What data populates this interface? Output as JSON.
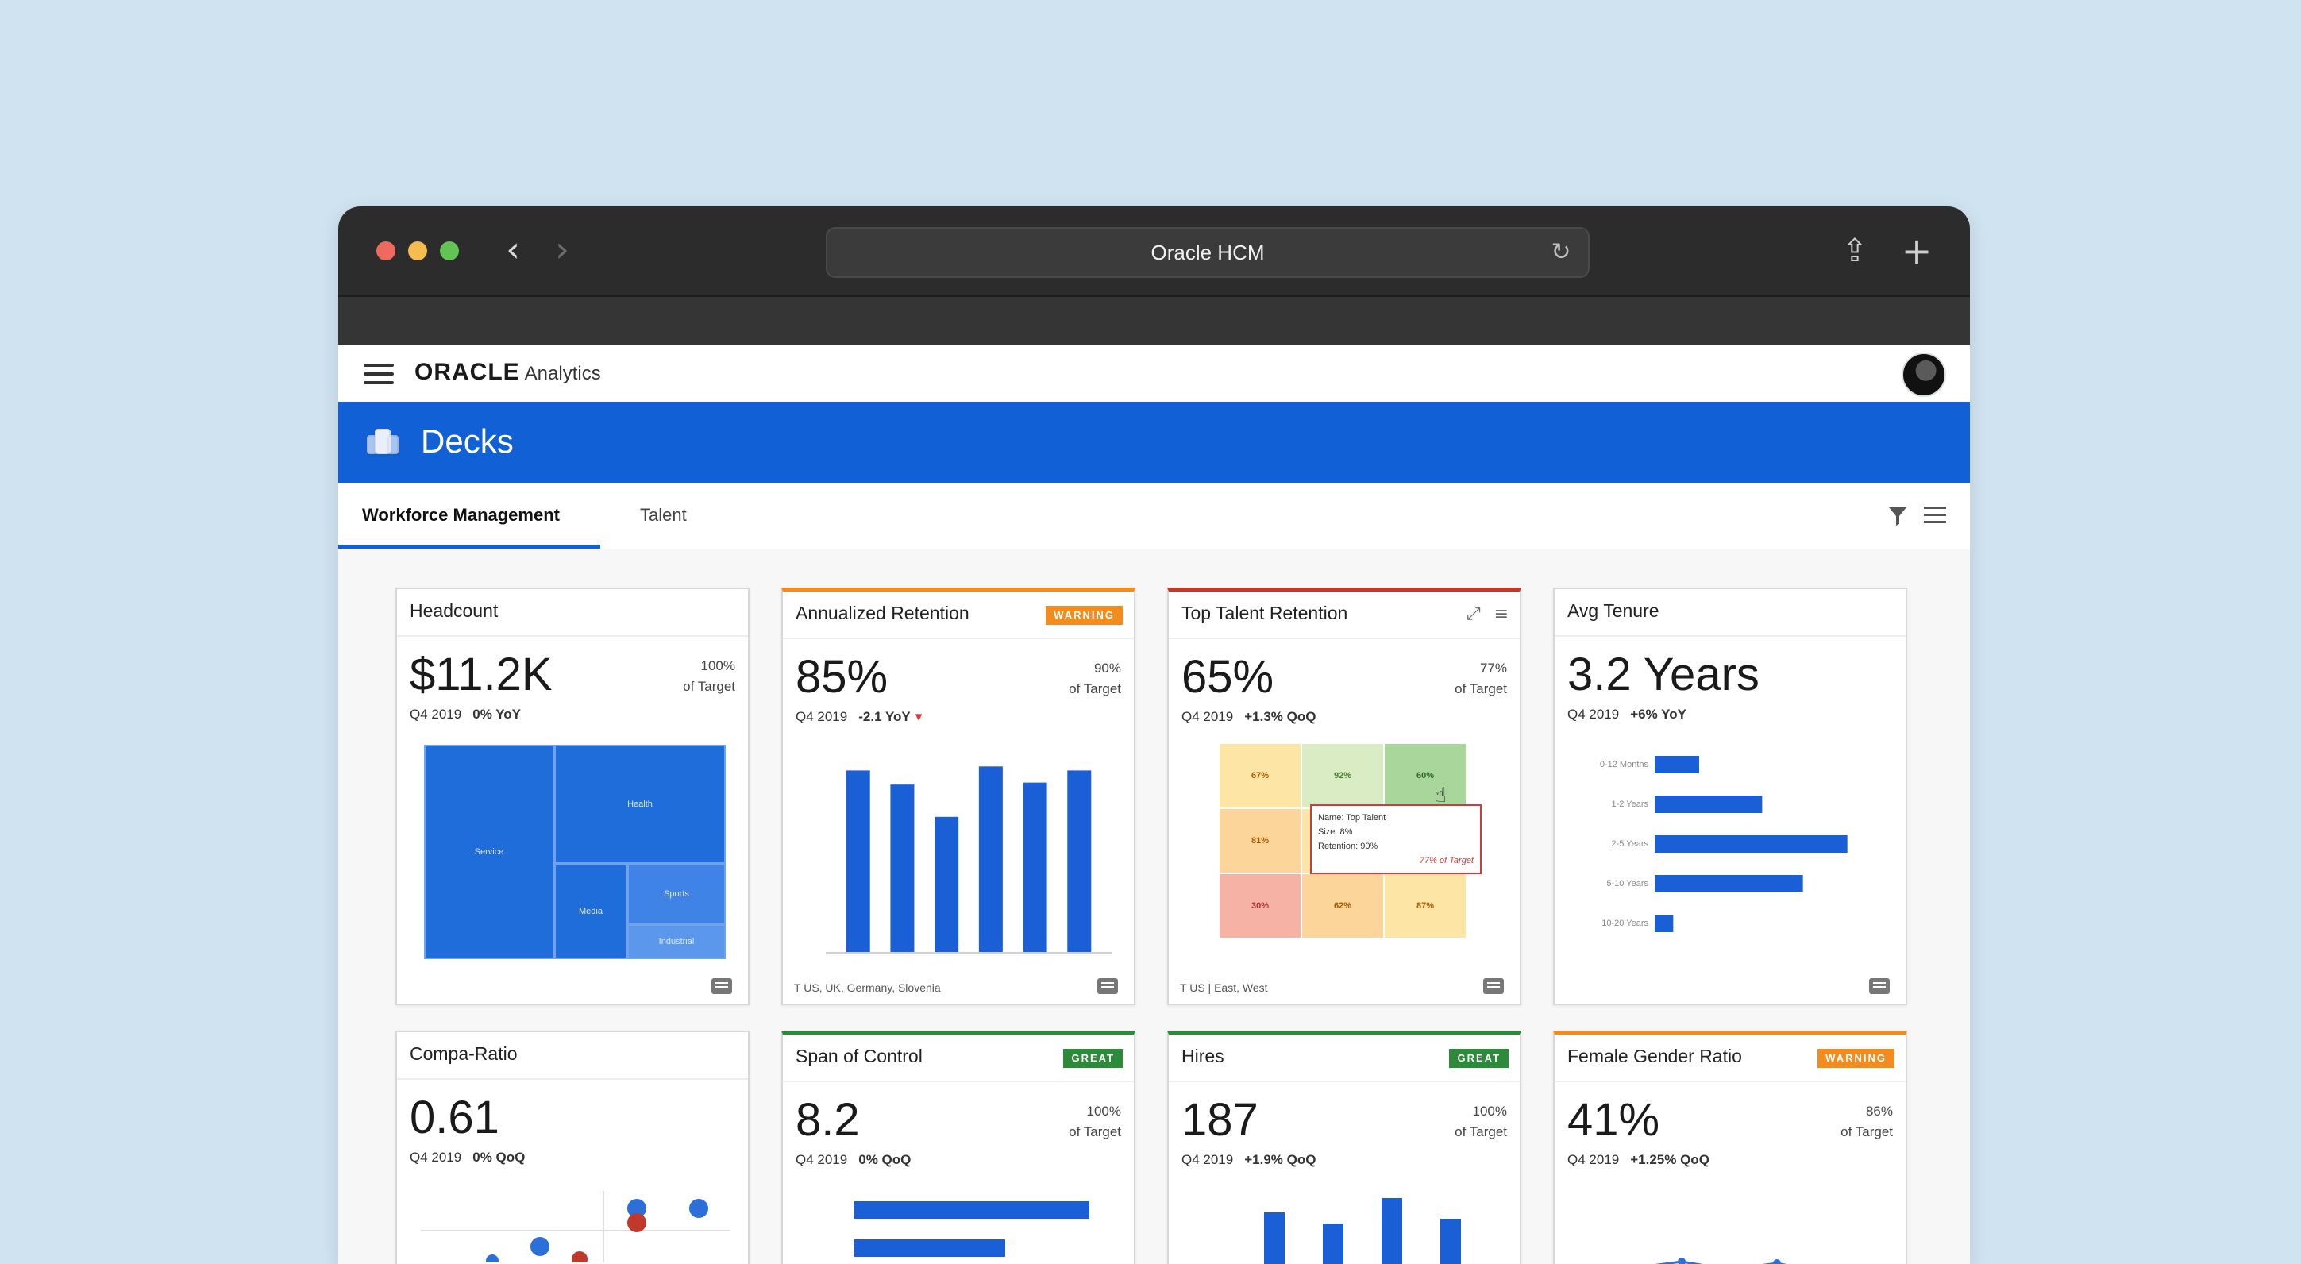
{
  "browser": {
    "url_title": "Oracle HCM",
    "back_icon": "chevron-left-icon",
    "forward_icon": "chevron-right-icon",
    "reload_icon": "reload-icon",
    "share_icon": "share-icon",
    "new_tab_icon": "plus-icon"
  },
  "app": {
    "logo": "ORACLE",
    "logo_sub": "Analytics",
    "section_title": "Decks",
    "tabs": [
      {
        "label": "Workforce Management",
        "active": true
      },
      {
        "label": "Talent",
        "active": false
      }
    ]
  },
  "cards": [
    {
      "title": "Headcount",
      "value": "$11.2K",
      "target_pct": "100%",
      "target_label": "of Target",
      "period": "Q4 2019",
      "delta": "0% YoY",
      "treemap": [
        "Service",
        "Health",
        "Media",
        "Sports",
        "Industrial"
      ]
    },
    {
      "title": "Annualized Retention",
      "badge": "WARNING",
      "value": "85%",
      "target_pct": "90%",
      "target_label": "of Target",
      "period": "Q4 2019",
      "delta": "-2.1 YoY",
      "footer": "US, UK, Germany, Slovenia",
      "bars": [
        90,
        83,
        67,
        92,
        84,
        90
      ]
    },
    {
      "title": "Top Talent Retention",
      "value": "65%",
      "target_pct": "77%",
      "target_label": "of Target",
      "period": "Q4 2019",
      "delta": "+1.3% QoQ",
      "footer": "US | East, West",
      "heatmap": [
        "67%",
        "92%",
        "60%",
        "81%",
        "",
        "",
        "30%",
        "62%",
        "87%"
      ],
      "tooltip": {
        "line1": "Name: Top Talent",
        "line2": "Size: 8%",
        "line3": "Retention: 90%",
        "line4": "77% of Target"
      }
    },
    {
      "title": "Avg Tenure",
      "value": "3.2 Years",
      "period": "Q4 2019",
      "delta": "+6% YoY",
      "hbars": [
        {
          "label": "0-12 Months",
          "value": 1.2
        },
        {
          "label": "1-2 Years",
          "value": 2.9
        },
        {
          "label": "2-5 Years",
          "value": 5.2
        },
        {
          "label": "5-10 Years",
          "value": 4.0
        },
        {
          "label": "10-20 Years",
          "value": 0.5
        }
      ]
    },
    {
      "title": "Compa-Ratio",
      "value": "0.61",
      "period": "Q4 2019",
      "delta": "0% QoQ"
    },
    {
      "title": "Span of Control",
      "badge": "GREAT",
      "value": "8.2",
      "target_pct": "100%",
      "target_label": "of Target",
      "period": "Q4 2019",
      "delta": "0% QoQ"
    },
    {
      "title": "Hires",
      "badge": "GREAT",
      "value": "187",
      "target_pct": "100%",
      "target_label": "of Target",
      "period": "Q4 2019",
      "delta": "+1.9% QoQ"
    },
    {
      "title": "Female Gender Ratio",
      "badge": "WARNING",
      "value": "41%",
      "target_pct": "86%",
      "target_label": "of Target",
      "period": "Q4 2019",
      "delta": "+1.25% QoQ"
    }
  ],
  "colors": {
    "brand_blue": "#1160d6",
    "warning": "#f28c1e",
    "great": "#2c8a3a",
    "bar_blue": "#1a5fd6"
  }
}
